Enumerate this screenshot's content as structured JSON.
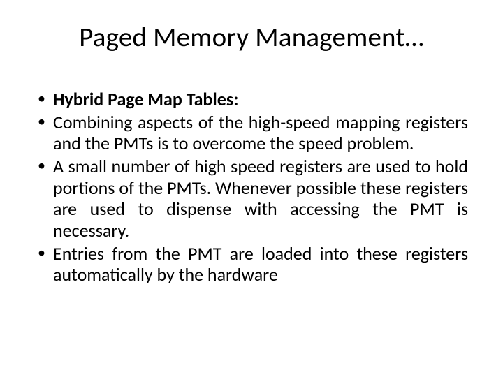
{
  "title": "Paged Memory Management…",
  "bullets": [
    {
      "text": "Hybrid Page Map Tables:",
      "bold": true
    },
    {
      "text": "Combining aspects of the high-speed mapping registers and the PMTs is to overcome the speed problem.",
      "bold": false
    },
    {
      "text": "A small number of high speed registers are used to hold portions of the PMTs. Whenever possible these registers are used to dispense with accessing the PMT is necessary.",
      "bold": false
    },
    {
      "text": "Entries from the PMT are loaded into these registers automatically by the hardware",
      "bold": false
    }
  ]
}
